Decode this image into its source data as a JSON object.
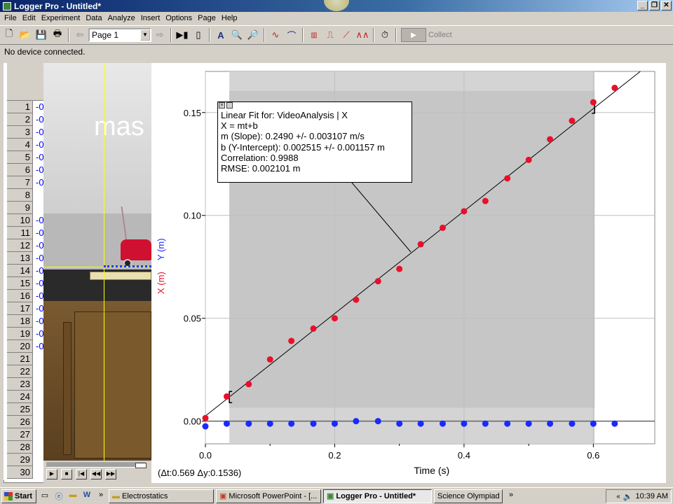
{
  "window": {
    "title": "Logger Pro - Untitled*",
    "min_label": "_",
    "max_label": "❐",
    "close_label": "✕"
  },
  "menu": [
    "File",
    "Edit",
    "Experiment",
    "Data",
    "Analyze",
    "Insert",
    "Options",
    "Page",
    "Help"
  ],
  "toolbar": {
    "page_select": "Page 1",
    "collect_label": "Collect",
    "icons": [
      "new-icon",
      "open-icon",
      "save-icon",
      "print-icon",
      "prev-page-icon",
      "next-page-icon",
      "video-icon",
      "lab-interface-icon",
      "autoscale-icon",
      "zoom-in-icon",
      "zoom-out-icon",
      "examine-icon",
      "tangent-icon",
      "statistics-icon",
      "integral-icon",
      "linear-fit-icon",
      "curve-fit-icon",
      "clock-icon"
    ]
  },
  "status_text": "No device connected.",
  "spreadsheet": {
    "rows": [
      {
        "n": "1",
        "v": "-0"
      },
      {
        "n": "2",
        "v": "-0"
      },
      {
        "n": "3",
        "v": "-0"
      },
      {
        "n": "4",
        "v": "-0"
      },
      {
        "n": "5",
        "v": "-0"
      },
      {
        "n": "6",
        "v": "-0"
      },
      {
        "n": "7",
        "v": "-0"
      },
      {
        "n": "8",
        "v": ""
      },
      {
        "n": "9",
        "v": ""
      },
      {
        "n": "10",
        "v": "-0"
      },
      {
        "n": "11",
        "v": "-0"
      },
      {
        "n": "12",
        "v": "-0"
      },
      {
        "n": "13",
        "v": "-0"
      },
      {
        "n": "14",
        "v": "-0"
      },
      {
        "n": "15",
        "v": "-0"
      },
      {
        "n": "16",
        "v": "-0"
      },
      {
        "n": "17",
        "v": "-0"
      },
      {
        "n": "18",
        "v": "-0"
      },
      {
        "n": "19",
        "v": "-0"
      },
      {
        "n": "20",
        "v": "-0"
      },
      {
        "n": "21",
        "v": ""
      },
      {
        "n": "22",
        "v": ""
      },
      {
        "n": "23",
        "v": ""
      },
      {
        "n": "24",
        "v": ""
      },
      {
        "n": "25",
        "v": ""
      },
      {
        "n": "26",
        "v": ""
      },
      {
        "n": "27",
        "v": ""
      },
      {
        "n": "28",
        "v": ""
      },
      {
        "n": "29",
        "v": ""
      },
      {
        "n": "30",
        "v": ""
      }
    ]
  },
  "video": {
    "wall_text": "mas"
  },
  "fit_box": {
    "line1": "Linear Fit for: VideoAnalysis | X",
    "line2": "X = mt+b",
    "line3": "m (Slope): 0.2490 +/- 0.003107 m/s",
    "line4": "b (Y-Intercept): 0.002515 +/- 0.001157 m",
    "line5": "Correlation: 0.9988",
    "line6": "RMSE: 0.002101 m"
  },
  "delta_readout": "(Δt:0.569  Δy:0.1536)",
  "chart_data": {
    "type": "scatter",
    "xlabel": "Time (s)",
    "ylabel_x": "X (m)",
    "ylabel_y": "Y (m)",
    "xlim": [
      0,
      0.695
    ],
    "ylim": [
      -0.011,
      0.17
    ],
    "x_ticks": [
      "0.0",
      "0.2",
      "0.4",
      "0.6"
    ],
    "y_ticks": [
      "0.00",
      "0.05",
      "0.10",
      "0.15"
    ],
    "selection_range": [
      0.037,
      0.602
    ],
    "fit": {
      "m": 0.249,
      "b": 0.002515
    },
    "series": [
      {
        "name": "X (m)",
        "color": "#e8102a",
        "points": [
          [
            0.0,
            0.0015
          ],
          [
            0.033,
            0.012
          ],
          [
            0.067,
            0.018
          ],
          [
            0.1,
            0.03
          ],
          [
            0.133,
            0.039
          ],
          [
            0.167,
            0.045
          ],
          [
            0.2,
            0.05
          ],
          [
            0.233,
            0.059
          ],
          [
            0.267,
            0.068
          ],
          [
            0.3,
            0.074
          ],
          [
            0.333,
            0.086
          ],
          [
            0.367,
            0.094
          ],
          [
            0.4,
            0.102
          ],
          [
            0.433,
            0.107
          ],
          [
            0.467,
            0.118
          ],
          [
            0.5,
            0.127
          ],
          [
            0.533,
            0.137
          ],
          [
            0.567,
            0.146
          ],
          [
            0.6,
            0.155
          ],
          [
            0.633,
            0.162
          ]
        ]
      },
      {
        "name": "Y (m)",
        "color": "#1a2aff",
        "points": [
          [
            0.0,
            -0.0025
          ],
          [
            0.033,
            -0.0012
          ],
          [
            0.067,
            -0.0012
          ],
          [
            0.1,
            -0.0012
          ],
          [
            0.133,
            -0.0012
          ],
          [
            0.167,
            -0.0012
          ],
          [
            0.2,
            -0.0012
          ],
          [
            0.233,
            0.0
          ],
          [
            0.267,
            0.0
          ],
          [
            0.3,
            -0.0012
          ],
          [
            0.333,
            -0.0012
          ],
          [
            0.367,
            -0.0012
          ],
          [
            0.4,
            -0.0012
          ],
          [
            0.433,
            -0.0012
          ],
          [
            0.467,
            -0.0012
          ],
          [
            0.5,
            -0.0012
          ],
          [
            0.533,
            -0.0012
          ],
          [
            0.567,
            -0.0012
          ],
          [
            0.6,
            -0.0012
          ],
          [
            0.633,
            -0.0012
          ]
        ]
      }
    ]
  },
  "taskbar": {
    "start_label": "Start",
    "overflow": "»",
    "tasks": [
      "Electrostatics",
      "Microsoft PowerPoint - [...",
      "Logger Pro - Untitled*",
      "Science Olympiad"
    ],
    "tray_chev": "«",
    "clock": "10:39 AM"
  }
}
